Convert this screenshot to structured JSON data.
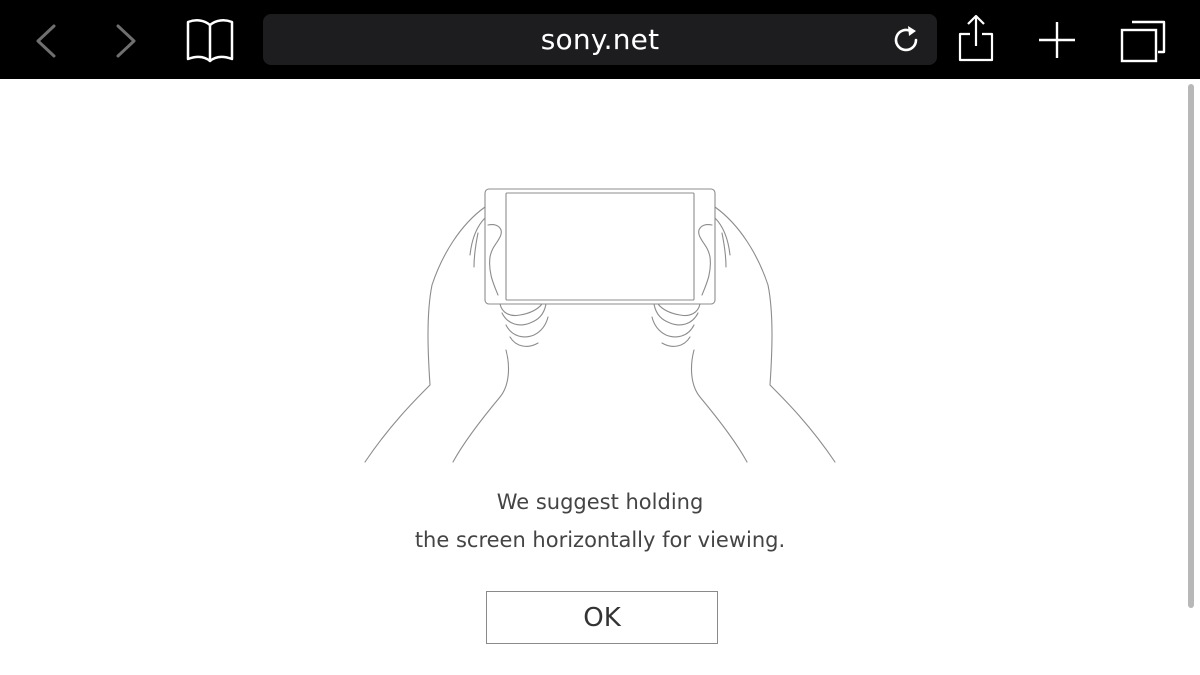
{
  "browser": {
    "url": "sony.net",
    "icons": {
      "back": "chevron-left-icon",
      "forward": "chevron-right-icon",
      "bookmarks": "open-book-icon",
      "reload": "reload-icon",
      "share": "share-icon",
      "new_tab": "plus-icon",
      "tabs": "tabs-icon"
    }
  },
  "dialog": {
    "message_line1": "We suggest holding",
    "message_line2": "the screen horizontally for viewing.",
    "ok_label": "OK"
  },
  "colors": {
    "toolbar_bg": "#000000",
    "url_bar_bg": "#1d1d1f",
    "page_bg": "#ffffff",
    "text": "#444444",
    "button_border": "#8a8a8a"
  }
}
